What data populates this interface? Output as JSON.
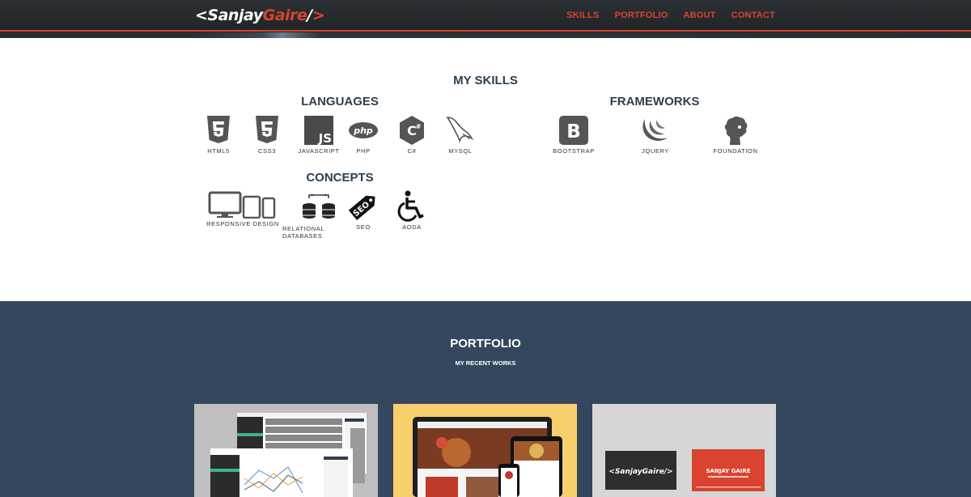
{
  "brand": {
    "part1": "<Sanjay",
    "part2": "Gaire",
    "part3": "/",
    "part4": ">"
  },
  "nav": {
    "skills": "SKILLS",
    "portfolio": "PORTFOLIO",
    "about": "ABOUT",
    "contact": "CONTACT"
  },
  "skills": {
    "title": "MY SKILLS",
    "languages": {
      "title": "LANGUAGES",
      "items": [
        {
          "label": "HTML5",
          "icon": "html5-icon"
        },
        {
          "label": "CSS3",
          "icon": "css3-icon"
        },
        {
          "label": "JAVASCRIPT",
          "icon": "javascript-icon"
        },
        {
          "label": "PHP",
          "icon": "php-icon"
        },
        {
          "label": "C#",
          "icon": "csharp-icon"
        },
        {
          "label": "MYSQL",
          "icon": "mysql-icon"
        }
      ]
    },
    "frameworks": {
      "title": "FRAMEWORKS",
      "items": [
        {
          "label": "BOOTSTRAP",
          "icon": "bootstrap-icon"
        },
        {
          "label": "JQUERY",
          "icon": "jquery-icon"
        },
        {
          "label": "FOUNDATION",
          "icon": "foundation-icon"
        }
      ]
    },
    "concepts": {
      "title": "CONCEPTS",
      "items": [
        {
          "label": "RESPONSIVE DESIGN",
          "icon": "responsive-devices-icon"
        },
        {
          "label": "RELATIONAL DATABASES",
          "icon": "database-icon"
        },
        {
          "label": "SEO",
          "icon": "seo-tag-icon"
        },
        {
          "label": "AODA",
          "icon": "accessibility-icon"
        }
      ]
    }
  },
  "portfolio": {
    "title": "PORTFOLIO",
    "subtitle": "MY RECENT WORKS",
    "card3": {
      "logo": "<SanjayGaire/>",
      "name": "SANJAY GAIRE"
    }
  },
  "colors": {
    "accent": "#d9432f",
    "nav_bg": "#23272a",
    "heading": "#2d3e50",
    "portfolio_bg": "#34475e"
  }
}
